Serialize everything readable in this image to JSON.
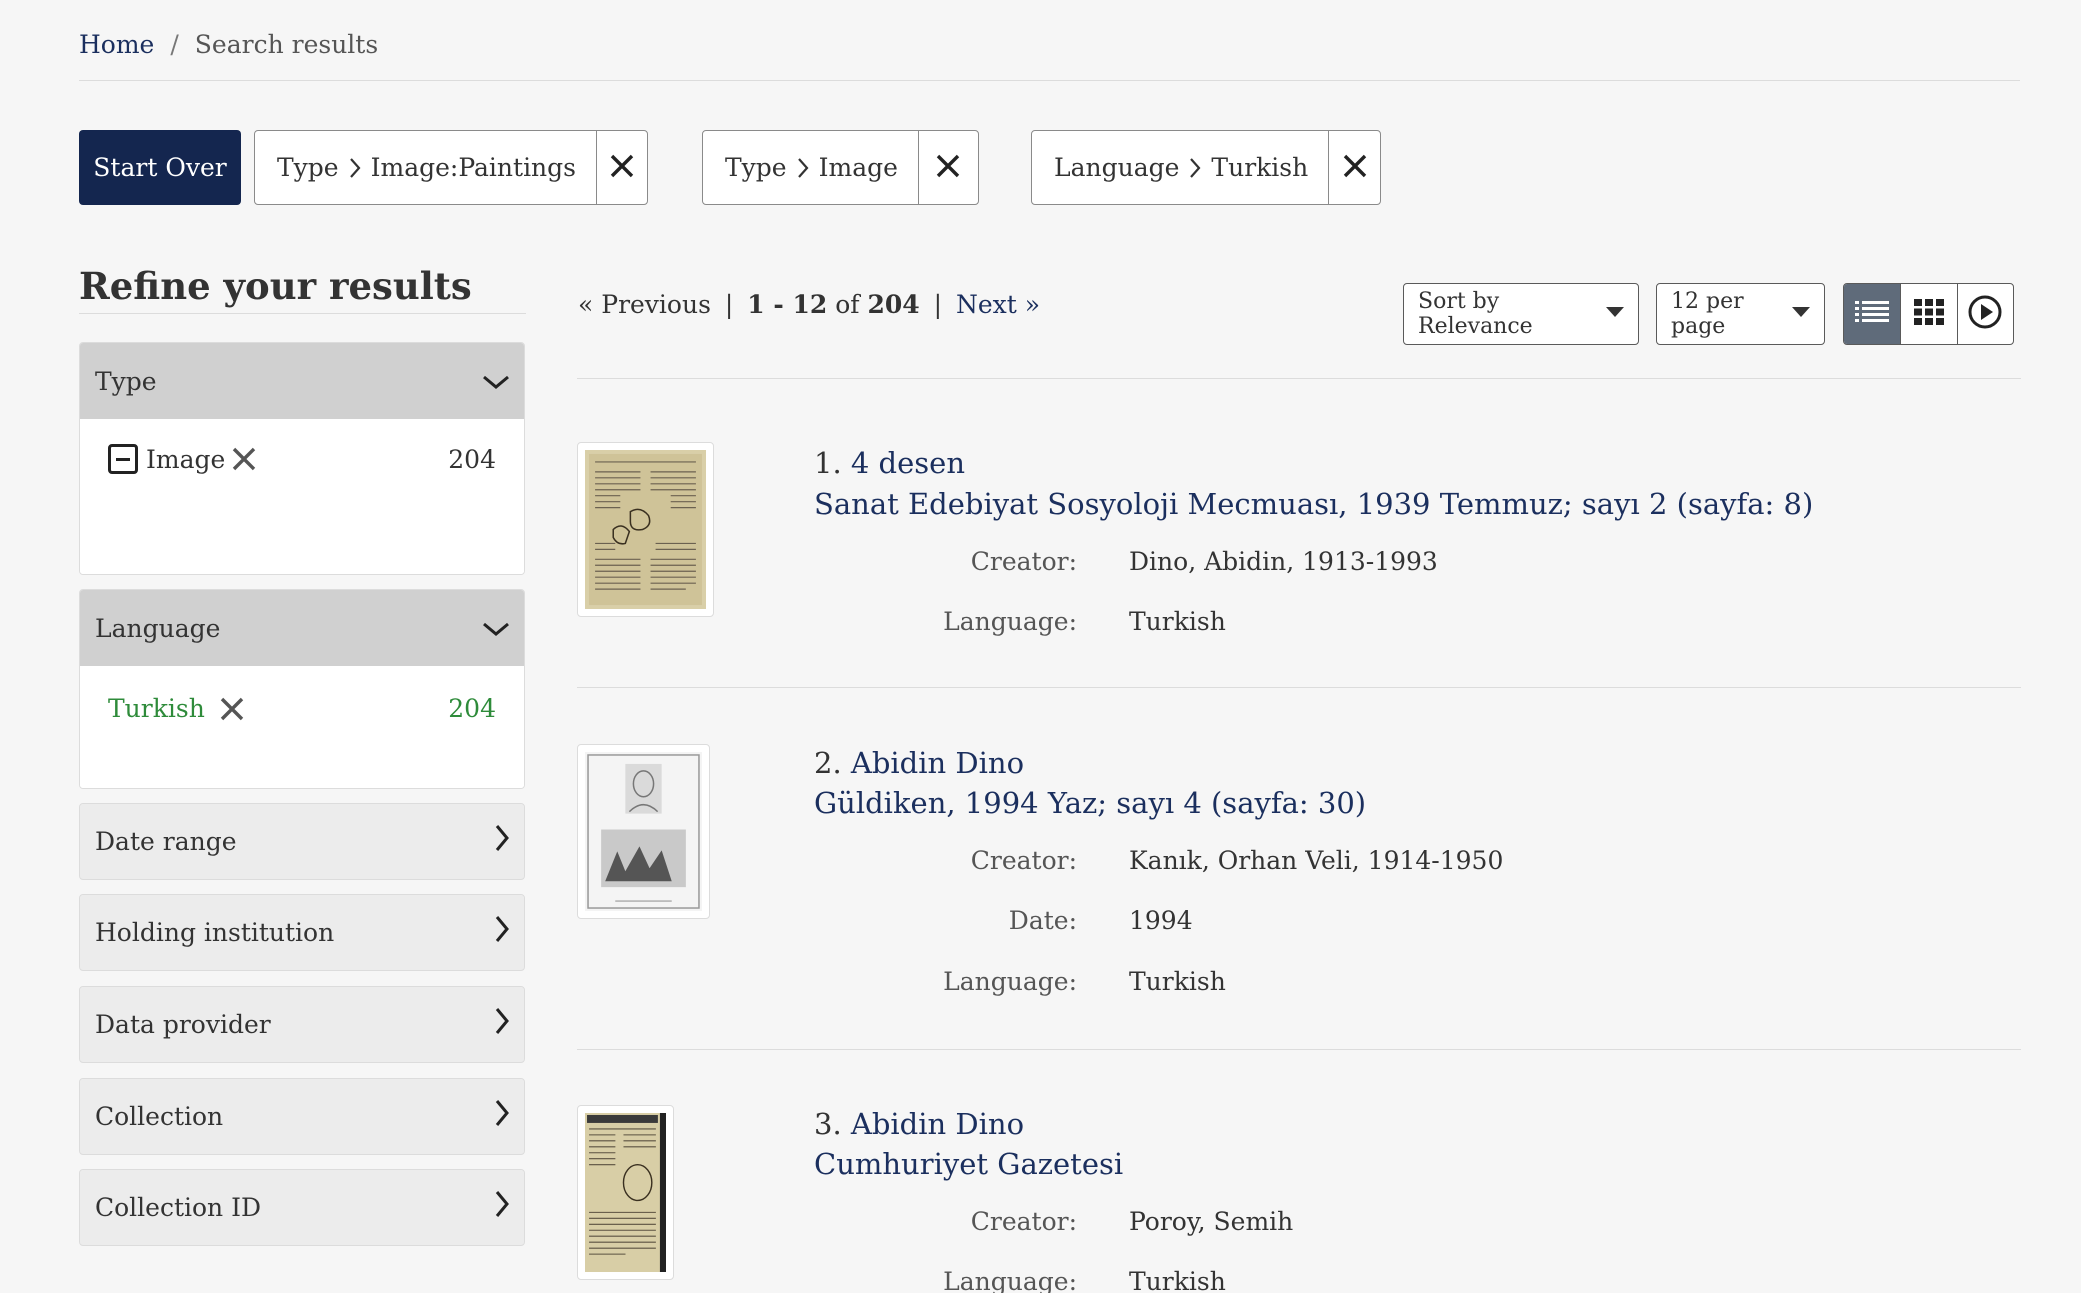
{
  "breadcrumb": {
    "home": "Home",
    "separator": "/",
    "current": "Search results"
  },
  "constraints": {
    "start_over": "Start Over",
    "chips": [
      {
        "field": "Type",
        "value": "Image:Paintings"
      },
      {
        "field": "Type",
        "value": "Image"
      },
      {
        "field": "Language",
        "value": "Turkish"
      }
    ]
  },
  "sidebar": {
    "title": "Refine your results",
    "type_facet": {
      "label": "Type",
      "item_label": "Image",
      "item_count": "204"
    },
    "language_facet": {
      "label": "Language",
      "item_label": "Turkish",
      "item_count": "204"
    },
    "collapsed": [
      "Date range",
      "Holding institution",
      "Data provider",
      "Collection",
      "Collection ID"
    ]
  },
  "pager": {
    "previous": "« Previous",
    "range": "1 - 12",
    "of": "of",
    "total": "204",
    "next": "Next »"
  },
  "sort": {
    "label": "Sort by Relevance"
  },
  "per_page": {
    "label": "12 per page"
  },
  "results": [
    {
      "number": "1.",
      "title": "4 desen",
      "subtitle": "Sanat Edebiyat Sosyoloji Mecmuası, 1939 Temmuz; sayı 2 (sayfa: 8)",
      "meta": [
        {
          "label": "Creator:",
          "value": "Dino, Abidin, 1913-1993"
        },
        {
          "label": "Language:",
          "value": "Turkish"
        }
      ]
    },
    {
      "number": "2.",
      "title": "Abidin Dino",
      "subtitle": "Güldiken, 1994 Yaz; sayı 4 (sayfa: 30)",
      "meta": [
        {
          "label": "Creator:",
          "value": "Kanık, Orhan Veli, 1914-1950"
        },
        {
          "label": "Date:",
          "value": "1994"
        },
        {
          "label": "Language:",
          "value": "Turkish"
        }
      ]
    },
    {
      "number": "3.",
      "title": "Abidin Dino",
      "subtitle": "Cumhuriyet Gazetesi",
      "meta": [
        {
          "label": "Creator:",
          "value": "Poroy, Semih"
        },
        {
          "label": "Language:",
          "value": "Turkish"
        }
      ]
    }
  ],
  "colors": {
    "navy": "#1b2f5e",
    "start_over_bg": "#14264f",
    "facet_green": "#2e8b3a",
    "active_view": "#5f6b7a"
  }
}
